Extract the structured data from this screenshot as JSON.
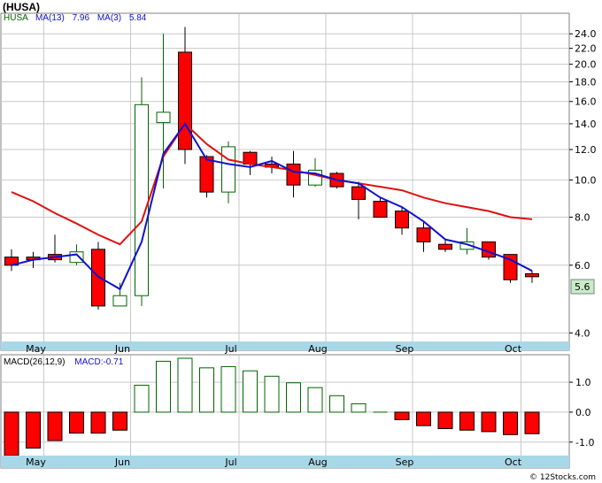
{
  "title": "(HUSA)",
  "legend": {
    "ticker": "HUSA",
    "ma13_label": "MA(13)",
    "ma13_value": "7.96",
    "ma3_label": "MA(3)",
    "ma3_value": "5.84",
    "macd_params": "MACD(26,12,9)",
    "macd_value": "MACD:-0.71"
  },
  "colors": {
    "up": "#006400",
    "down": "#ff0000",
    "ma13": "#e01010",
    "ma3": "#1010d0",
    "axis_band": "#a8d8e8",
    "grid": "#c8c8c8",
    "price_badge": "#c8ecc8"
  },
  "last_price_label": "5.6",
  "footer": "© 12Stocks.com",
  "chart_data": [
    {
      "type": "candlestick",
      "scale": "log",
      "ylim": [
        3.8,
        27
      ],
      "yticks": [
        4.0,
        6.0,
        8.0,
        10.0,
        12.0,
        14.0,
        16.0,
        18.0,
        20.0,
        22.0,
        24.0
      ],
      "yticklabels": [
        "4.0",
        "6.0",
        "8.0",
        "10.0",
        "12.0",
        "14.0",
        "16.0",
        "18.0",
        "20.0",
        "22.0",
        "24.0"
      ],
      "xticklabels": [
        {
          "label": "May",
          "week": 1
        },
        {
          "label": "Jun",
          "week": 5
        },
        {
          "label": "Jul",
          "week": 10
        },
        {
          "label": "Aug",
          "week": 14
        },
        {
          "label": "Sep",
          "week": 18
        },
        {
          "label": "Oct",
          "week": 23
        }
      ],
      "candles": [
        {
          "o": 6.3,
          "h": 6.6,
          "l": 5.8,
          "c": 6.0
        },
        {
          "o": 6.3,
          "h": 6.5,
          "l": 5.9,
          "c": 6.2
        },
        {
          "o": 6.4,
          "h": 7.2,
          "l": 6.1,
          "c": 6.2
        },
        {
          "o": 6.1,
          "h": 6.8,
          "l": 6.0,
          "c": 6.5
        },
        {
          "o": 6.6,
          "h": 6.9,
          "l": 4.6,
          "c": 4.7
        },
        {
          "o": 4.7,
          "h": 5.4,
          "l": 4.7,
          "c": 5.0
        },
        {
          "o": 5.0,
          "h": 18.5,
          "l": 4.7,
          "c": 15.7
        },
        {
          "o": 14.1,
          "h": 24.0,
          "l": 9.5,
          "c": 15.0
        },
        {
          "o": 21.5,
          "h": 25.0,
          "l": 11.0,
          "c": 12.0
        },
        {
          "o": 11.5,
          "h": 11.6,
          "l": 9.0,
          "c": 9.3
        },
        {
          "o": 9.3,
          "h": 12.6,
          "l": 8.7,
          "c": 12.2
        },
        {
          "o": 11.8,
          "h": 11.9,
          "l": 10.3,
          "c": 11.0
        },
        {
          "o": 11.0,
          "h": 11.5,
          "l": 10.4,
          "c": 10.8
        },
        {
          "o": 11.0,
          "h": 11.9,
          "l": 9.0,
          "c": 9.7
        },
        {
          "o": 9.7,
          "h": 11.4,
          "l": 9.6,
          "c": 10.6
        },
        {
          "o": 10.4,
          "h": 10.5,
          "l": 9.5,
          "c": 9.6
        },
        {
          "o": 9.6,
          "h": 9.9,
          "l": 7.9,
          "c": 8.9
        },
        {
          "o": 8.8,
          "h": 9.0,
          "l": 8.0,
          "c": 8.0
        },
        {
          "o": 8.3,
          "h": 8.5,
          "l": 7.2,
          "c": 7.5
        },
        {
          "o": 7.5,
          "h": 7.8,
          "l": 6.5,
          "c": 6.9
        },
        {
          "o": 6.8,
          "h": 7.0,
          "l": 6.5,
          "c": 6.6
        },
        {
          "o": 6.6,
          "h": 7.5,
          "l": 6.4,
          "c": 6.9
        },
        {
          "o": 6.9,
          "h": 6.9,
          "l": 6.2,
          "c": 6.3
        },
        {
          "o": 6.4,
          "h": 6.4,
          "l": 5.4,
          "c": 5.5
        },
        {
          "o": 5.7,
          "h": 5.8,
          "l": 5.4,
          "c": 5.6
        }
      ],
      "ma13": [
        {
          "week": 0,
          "v": 9.3
        },
        {
          "week": 1,
          "v": 8.8
        },
        {
          "week": 2,
          "v": 8.2
        },
        {
          "week": 3,
          "v": 7.7
        },
        {
          "week": 4,
          "v": 7.2
        },
        {
          "week": 5,
          "v": 6.8
        },
        {
          "week": 6,
          "v": 7.8
        },
        {
          "week": 7,
          "v": 11.5
        },
        {
          "week": 8,
          "v": 14.0
        },
        {
          "week": 9,
          "v": 12.4
        },
        {
          "week": 10,
          "v": 11.3
        },
        {
          "week": 11,
          "v": 11.0
        },
        {
          "week": 12,
          "v": 10.8
        },
        {
          "week": 13,
          "v": 10.6
        },
        {
          "week": 14,
          "v": 10.3
        },
        {
          "week": 15,
          "v": 10.0
        },
        {
          "week": 16,
          "v": 9.8
        },
        {
          "week": 17,
          "v": 9.6
        },
        {
          "week": 18,
          "v": 9.4
        },
        {
          "week": 19,
          "v": 9.0
        },
        {
          "week": 20,
          "v": 8.7
        },
        {
          "week": 21,
          "v": 8.5
        },
        {
          "week": 22,
          "v": 8.3
        },
        {
          "week": 23,
          "v": 8.0
        },
        {
          "week": 24,
          "v": 7.9
        }
      ],
      "ma3": [
        {
          "week": 0,
          "v": 6.0
        },
        {
          "week": 1,
          "v": 6.2
        },
        {
          "week": 2,
          "v": 6.3
        },
        {
          "week": 3,
          "v": 6.4
        },
        {
          "week": 4,
          "v": 5.6
        },
        {
          "week": 5,
          "v": 5.2
        },
        {
          "week": 6,
          "v": 6.9
        },
        {
          "week": 7,
          "v": 11.7
        },
        {
          "week": 8,
          "v": 14.0
        },
        {
          "week": 9,
          "v": 11.3
        },
        {
          "week": 10,
          "v": 11.0
        },
        {
          "week": 11,
          "v": 10.8
        },
        {
          "week": 12,
          "v": 11.2
        },
        {
          "week": 13,
          "v": 10.5
        },
        {
          "week": 14,
          "v": 10.4
        },
        {
          "week": 15,
          "v": 10.0
        },
        {
          "week": 16,
          "v": 9.8
        },
        {
          "week": 17,
          "v": 9.0
        },
        {
          "week": 18,
          "v": 8.5
        },
        {
          "week": 19,
          "v": 7.8
        },
        {
          "week": 20,
          "v": 7.0
        },
        {
          "week": 21,
          "v": 6.8
        },
        {
          "week": 22,
          "v": 6.5
        },
        {
          "week": 23,
          "v": 6.2
        },
        {
          "week": 24,
          "v": 5.8
        }
      ]
    },
    {
      "type": "bar",
      "title": "MACD(26,12,9)",
      "ylim": [
        -1.45,
        1.8
      ],
      "yticks": [
        -1.0,
        0.0,
        1.0
      ],
      "yticklabels": [
        "-1.0",
        "0.0",
        "1.0"
      ],
      "values": [
        -1.45,
        -1.2,
        -0.95,
        -0.7,
        -0.7,
        -0.6,
        0.9,
        1.7,
        1.8,
        1.48,
        1.52,
        1.38,
        1.2,
        0.98,
        0.82,
        0.55,
        0.28,
        0.0,
        -0.25,
        -0.45,
        -0.55,
        -0.6,
        -0.65,
        -0.75,
        -0.72
      ]
    }
  ]
}
